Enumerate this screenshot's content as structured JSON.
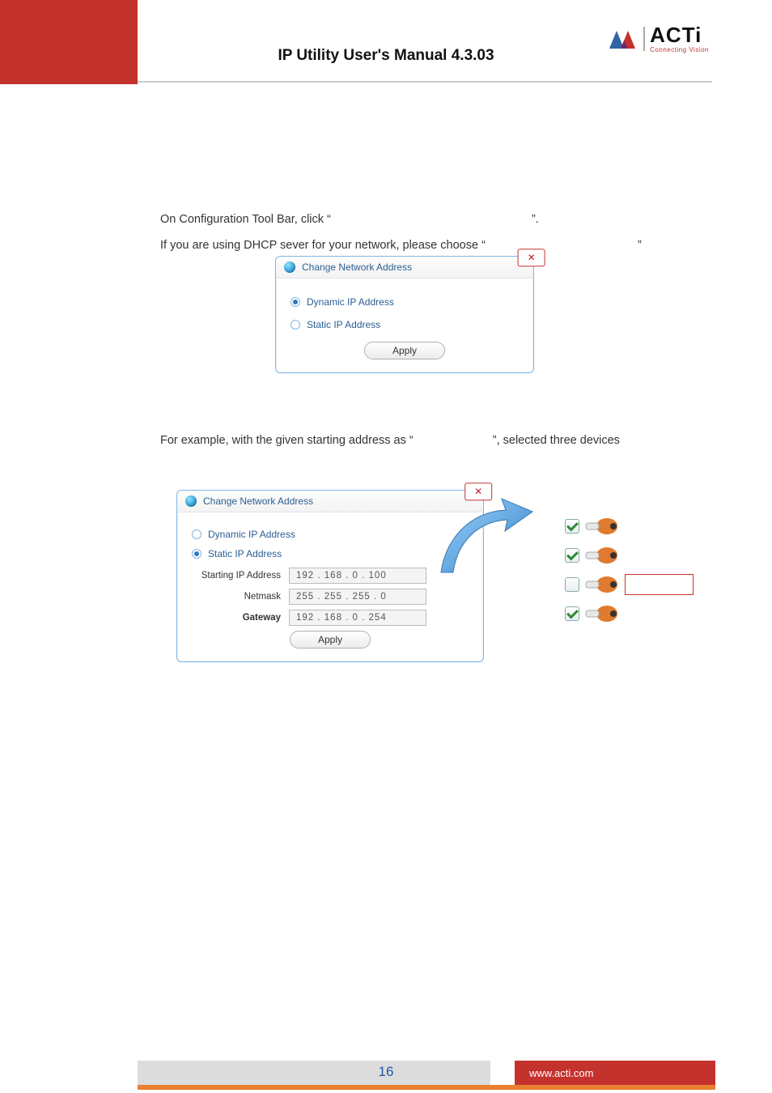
{
  "header": {
    "title": "IP Utility User's Manual 4.3.03",
    "logo_main": "ACTi",
    "logo_sub": "Connecting Vision"
  },
  "body": {
    "line1_a": "On Configuration Tool Bar, click “",
    "line1_b": "”.",
    "line2_a": "If you are using DHCP sever for your network, please choose “",
    "line2_b": "”",
    "line3_a": "For example, with the given starting address as “",
    "line3_b": "”, selected three devices"
  },
  "dialog1": {
    "title": "Change Network Address",
    "opt_dynamic": "Dynamic IP Address",
    "opt_static": "Static IP Address",
    "apply": "Apply"
  },
  "dialog2": {
    "title": "Change Network Address",
    "opt_dynamic": "Dynamic IP Address",
    "opt_static": "Static IP Address",
    "lbl_start": "Starting IP Address",
    "val_start": "192 . 168 .  0  . 100",
    "lbl_netmask": "Netmask",
    "val_netmask": "255 . 255 . 255 .  0",
    "lbl_gateway": "Gateway",
    "val_gateway": "192 . 168 .  0  . 254",
    "apply": "Apply"
  },
  "footer": {
    "page": "16",
    "site": "www.acti.com"
  }
}
